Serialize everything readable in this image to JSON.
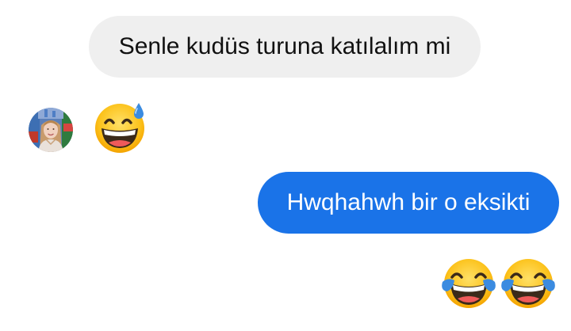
{
  "conversation": {
    "messages": [
      {
        "direction": "incoming",
        "type": "text",
        "text": "Senle kudüs turuna katılalım mi"
      },
      {
        "direction": "incoming",
        "type": "emoji",
        "emoji": "grinning-face-with-sweat"
      },
      {
        "direction": "outgoing",
        "type": "text",
        "text": "Hwqhahwh bir o eksikti"
      },
      {
        "direction": "outgoing",
        "type": "emoji",
        "emoji": "face-with-tears-of-joy",
        "count": 2
      }
    ]
  },
  "colors": {
    "incoming_bubble": "#efefef",
    "outgoing_bubble": "#1a73e8",
    "incoming_text": "#111111",
    "outgoing_text": "#ffffff"
  },
  "icons": {
    "avatar": "contact-avatar-photo",
    "emoji_1": "grinning-face-with-sweat-icon",
    "emoji_2": "face-with-tears-of-joy-icon"
  }
}
